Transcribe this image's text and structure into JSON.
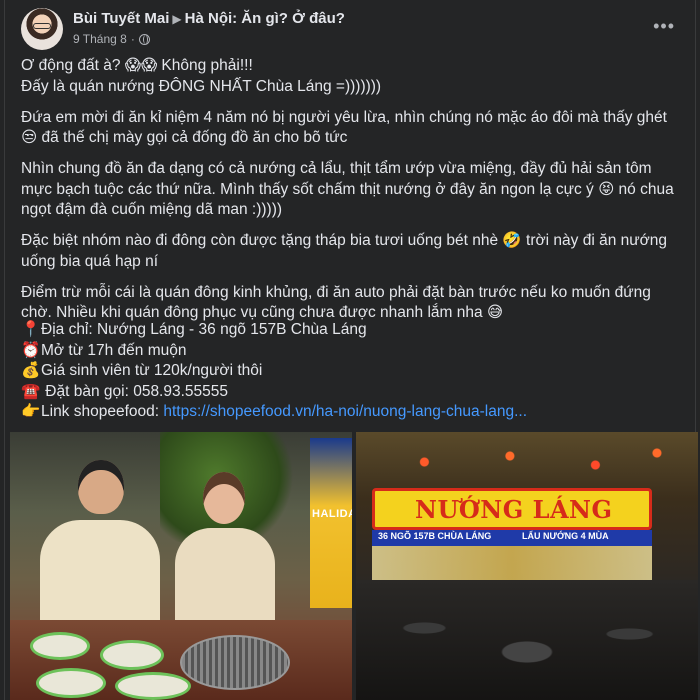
{
  "post": {
    "author": "Bùi Tuyết Mai",
    "group": "Hà Nội: Ăn gì? Ở đâu?",
    "date": "9 Tháng 8",
    "more_icon": "more-horizontal-icon",
    "privacy_icon": "globe-icon"
  },
  "body": {
    "p1_line1": "Ơ động đất à? 😱😱 Không phải!!!",
    "p1_line2": "Đấy là quán nướng ĐÔNG NHẤT Chùa Láng =)))))))",
    "p2": "Đứa em mời đi ăn kỉ niệm 4 năm nó bị người yêu lừa, nhìn chúng nó mặc áo đôi mà thấy ghét 😒 đã thế chị mày gọi cả đống đồ ăn cho bõ tức",
    "p3": "Nhìn chung đồ ăn đa dạng có cả nướng cả lẩu, thịt tẩm ướp vừa miệng, đầy đủ hải sản tôm mực bạch tuộc các thứ nữa. Mình thấy sốt chấm thịt nướng ở đây ăn ngon lạ cực ý 😝 nó chua ngọt đậm đà cuốn miệng dã man :)))))",
    "p4": "Đặc biệt nhóm nào đi đông còn được tặng tháp bia tươi uống bét nhè 🤣 trời này đi ăn nướng uống bia quá hạp ní",
    "p5": "Điểm trừ mỗi cái là quán đông kinh khủng, đi ăn auto phải đặt bàn trước nếu ko muốn đứng chờ. Nhiều khi quán đông phục vụ cũng chưa được nhanh lắm nha 😅"
  },
  "info": {
    "address_icon": "📍",
    "address": "Địa chỉ: Nướng Láng - 36 ngõ 157B Chùa Láng",
    "hours_icon": "⏰",
    "hours": "Mở từ 17h đến muộn",
    "price_icon": "💰",
    "price": "Giá sinh viên từ 120k/người thôi",
    "phone_icon": "☎️",
    "phone": " Đặt bàn gọi: 058.93.55555",
    "link_icon": "👉",
    "link_label": "Link shopeefood: ",
    "link_url": "https://shopeefood.vn/ha-noi/nuong-lang-chua-lang..."
  },
  "photos": {
    "left_sign": "HALIDA",
    "right_sign": "NƯỚNG LÁNG",
    "right_subsign_address": "36 NGÕ 157B CHÙA LÁNG",
    "right_subsign_tag": "LẨU NƯỚNG 4 MÙA"
  }
}
